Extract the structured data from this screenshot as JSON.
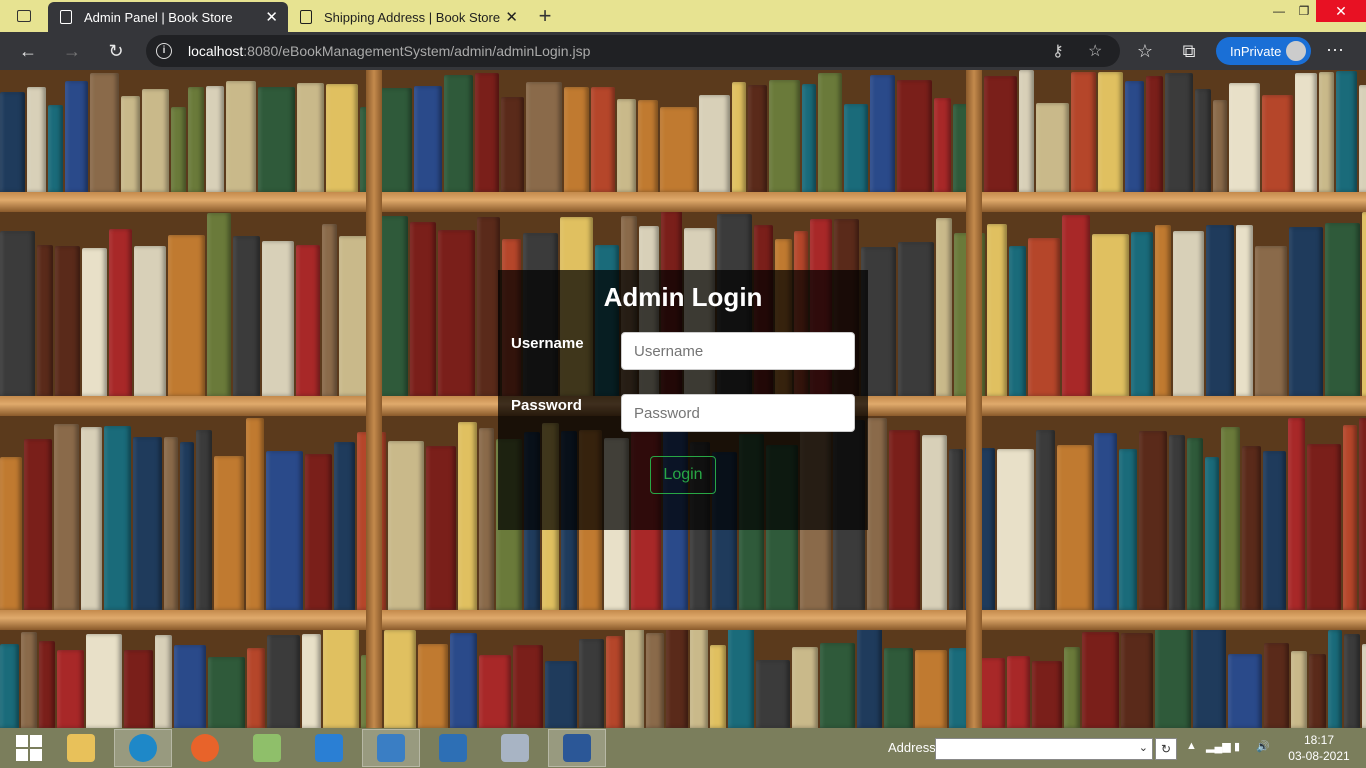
{
  "browser": {
    "tabs": [
      {
        "title": "Admin Panel | Book Store",
        "active": true
      },
      {
        "title": "Shipping Address | Book Store",
        "active": false
      }
    ],
    "url_host": "localhost",
    "url_rest": ":8080/eBookManagementSystem/admin/adminLogin.jsp",
    "inprivate_label": "InPrivate"
  },
  "login": {
    "title": "Admin Login",
    "username_label": "Username",
    "username_placeholder": "Username",
    "password_label": "Password",
    "password_placeholder": "Password",
    "button_label": "Login"
  },
  "taskbar": {
    "address_label": "Address",
    "time": "18:17",
    "date": "03-08-2021"
  },
  "colors": {
    "tab_strip": "#e7e391",
    "inprivate": "#1a6fd6",
    "login_button": "#28a745",
    "taskbar": "#7b7e5c"
  }
}
